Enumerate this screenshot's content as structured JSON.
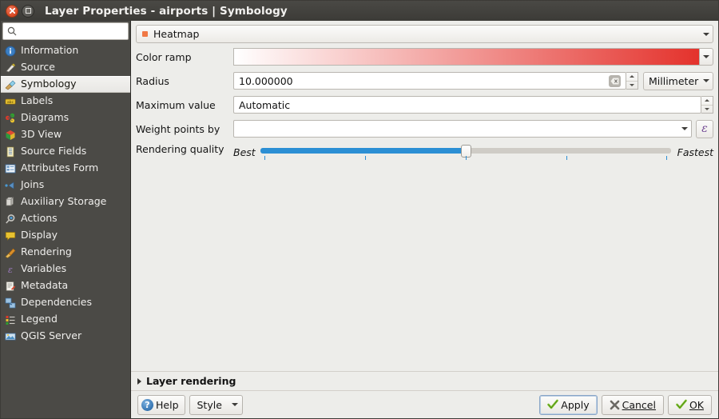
{
  "window": {
    "title": "Layer Properties - airports | Symbology",
    "close_tooltip": "Close",
    "maximize_tooltip": "Maximize"
  },
  "sidebar": {
    "search": {
      "value": "",
      "placeholder": ""
    },
    "items": [
      {
        "label": "Information",
        "icon": "information-icon",
        "selected": false
      },
      {
        "label": "Source",
        "icon": "source-icon",
        "selected": false
      },
      {
        "label": "Symbology",
        "icon": "symbology-icon",
        "selected": true
      },
      {
        "label": "Labels",
        "icon": "labels-icon",
        "selected": false
      },
      {
        "label": "Diagrams",
        "icon": "diagrams-icon",
        "selected": false
      },
      {
        "label": "3D View",
        "icon": "3d-view-icon",
        "selected": false
      },
      {
        "label": "Source Fields",
        "icon": "source-fields-icon",
        "selected": false
      },
      {
        "label": "Attributes Form",
        "icon": "attributes-form-icon",
        "selected": false
      },
      {
        "label": "Joins",
        "icon": "joins-icon",
        "selected": false
      },
      {
        "label": "Auxiliary Storage",
        "icon": "auxiliary-storage-icon",
        "selected": false
      },
      {
        "label": "Actions",
        "icon": "actions-icon",
        "selected": false
      },
      {
        "label": "Display",
        "icon": "display-icon",
        "selected": false
      },
      {
        "label": "Rendering",
        "icon": "rendering-icon",
        "selected": false
      },
      {
        "label": "Variables",
        "icon": "variables-icon",
        "selected": false
      },
      {
        "label": "Metadata",
        "icon": "metadata-icon",
        "selected": false
      },
      {
        "label": "Dependencies",
        "icon": "dependencies-icon",
        "selected": false
      },
      {
        "label": "Legend",
        "icon": "legend-icon",
        "selected": false
      },
      {
        "label": "QGIS Server",
        "icon": "qgis-server-icon",
        "selected": false
      }
    ]
  },
  "symbology": {
    "renderer": {
      "label": "Heatmap",
      "bullet_color": "#f07845"
    },
    "fields": {
      "color_ramp": {
        "label": "Color ramp",
        "ramp_start": "#ffffff",
        "ramp_end": "#e4322c"
      },
      "radius": {
        "label": "Radius",
        "value": "10.000000",
        "unit": "Millimeter"
      },
      "maximum_value": {
        "label": "Maximum value",
        "value": "Automatic"
      },
      "weight_points_by": {
        "label": "Weight points by",
        "value": "",
        "expression_symbol": "ɛ"
      },
      "rendering_quality": {
        "label": "Rendering quality",
        "min_label": "Best",
        "max_label": "Fastest",
        "value_percent": 50
      }
    }
  },
  "layer_rendering": {
    "label": "Layer rendering",
    "expanded": false
  },
  "buttons": {
    "help": "Help",
    "style": "Style",
    "apply": "Apply",
    "cancel": "Cancel",
    "ok": "OK"
  },
  "colors": {
    "titlebar_bg": "#3c3b37",
    "sidebar_bg": "#4b4a46",
    "content_bg": "#ededea",
    "slider_fill": "#2c8fd4",
    "accent_orange": "#f07845"
  }
}
